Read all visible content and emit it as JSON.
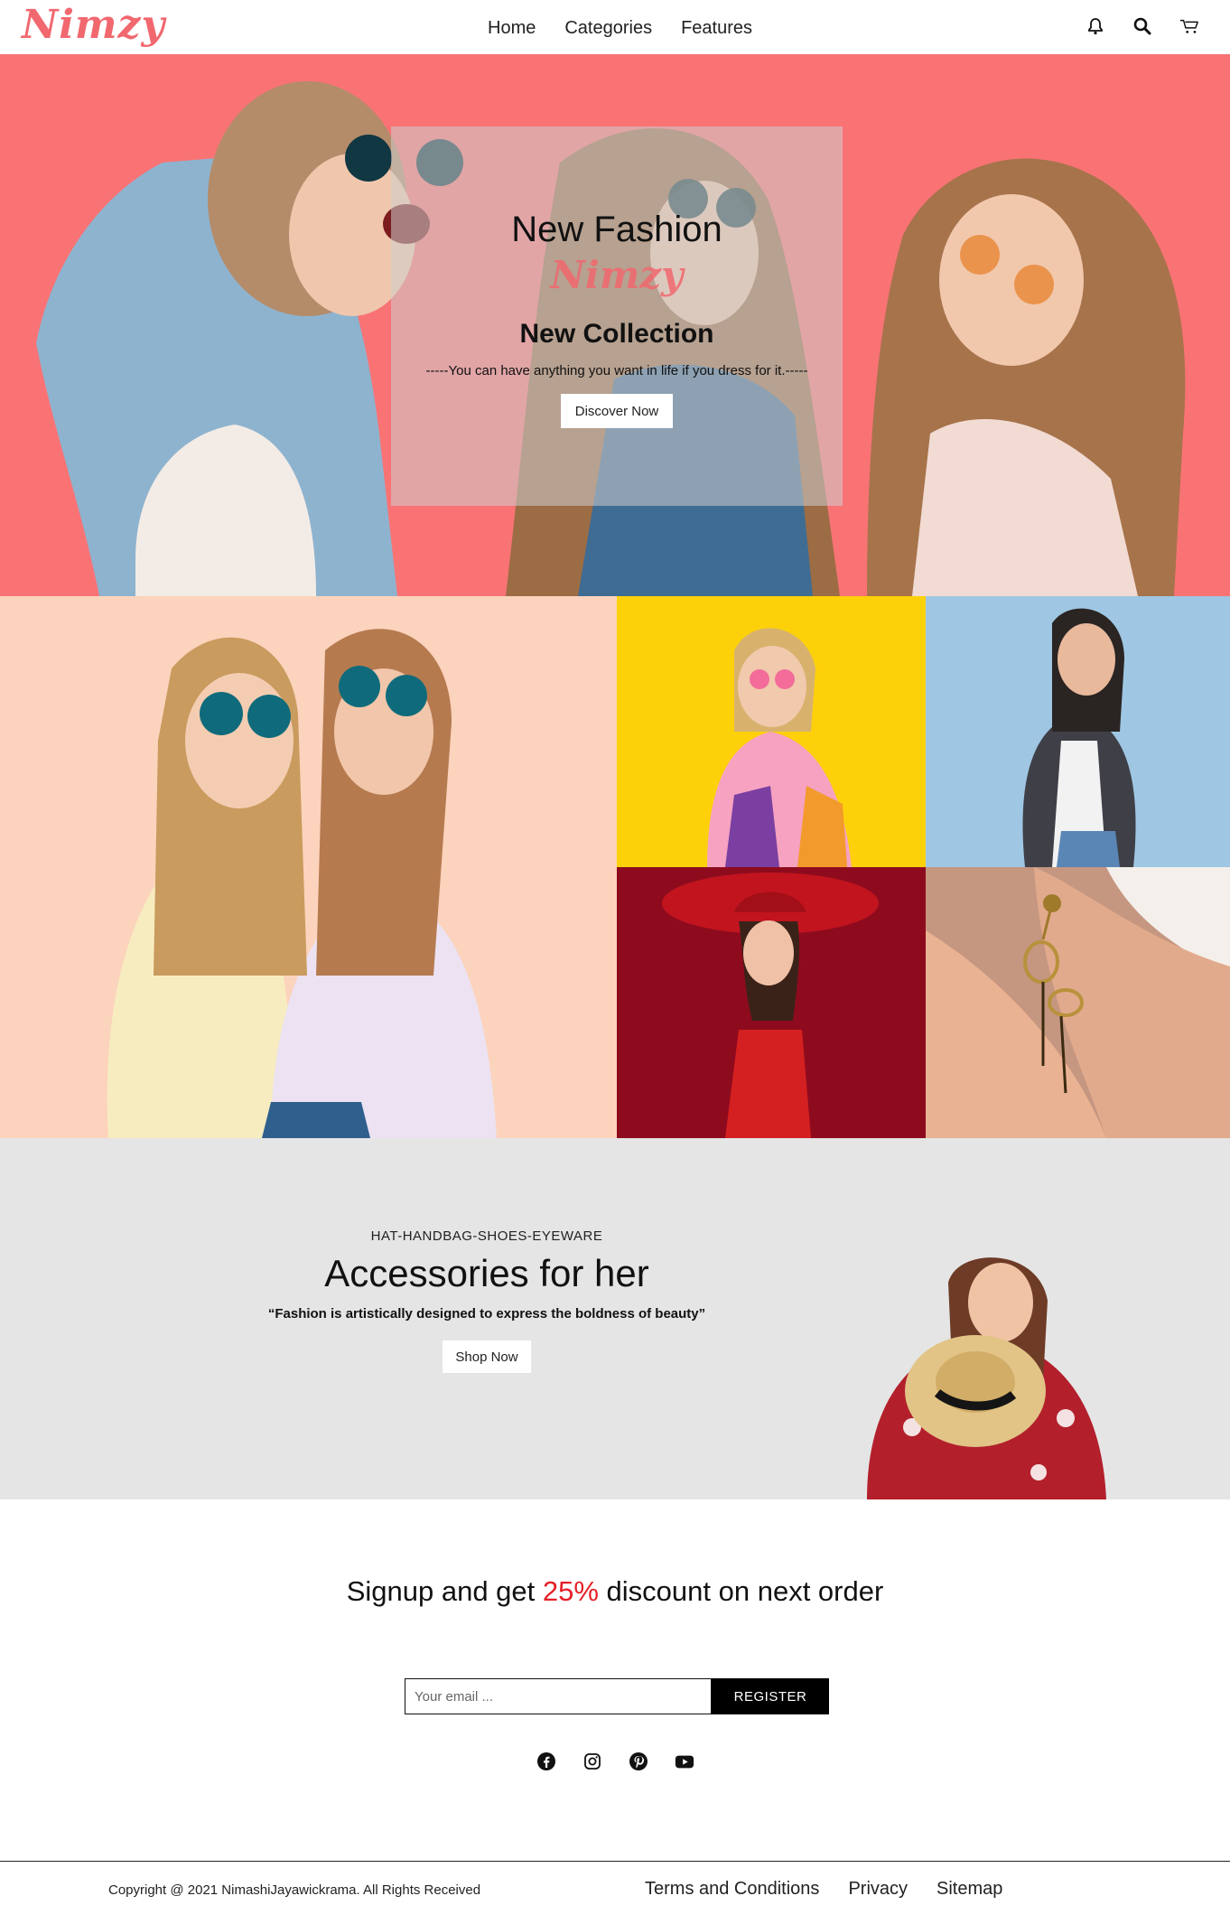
{
  "brand": {
    "logo": "Nimzy",
    "accent_color": "#f1686f"
  },
  "nav": {
    "links": [
      "Home",
      "Categories",
      "Features"
    ],
    "icons": [
      "bell-icon",
      "search-icon",
      "cart-icon"
    ]
  },
  "hero": {
    "title": "New Fashion",
    "brand": "Nimzy",
    "subtitle": "New Collection",
    "quote": "-----You can have anything you want in life if you dress for it.-----",
    "button": "Discover Now",
    "background_color": "#f97375"
  },
  "gallery": {
    "tiles": [
      "two-women-sunglasses",
      "woman-yellow-background",
      "woman-blue-background",
      "woman-red-hat",
      "earring-closeup"
    ]
  },
  "accessories": {
    "kicker": "HAT-HANDBAG-SHOES-EYEWARE",
    "title": "Accessories for her",
    "quote": "“Fashion is artistically designed to express the boldness of beauty”",
    "button": "Shop Now"
  },
  "signup": {
    "title_before": "Signup and get ",
    "title_accent": "25%",
    "title_after": " discount on next order",
    "accent_color": "#e52026",
    "email_placeholder": "Your email ...",
    "button": "REGISTER",
    "socials": [
      "facebook-icon",
      "instagram-icon",
      "pinterest-icon",
      "youtube-icon"
    ]
  },
  "footer": {
    "copyright": "Copyright @ 2021 NimashiJayawickrama. All Rights Received",
    "links": [
      "Terms and Conditions",
      "Privacy",
      "Sitemap"
    ]
  }
}
